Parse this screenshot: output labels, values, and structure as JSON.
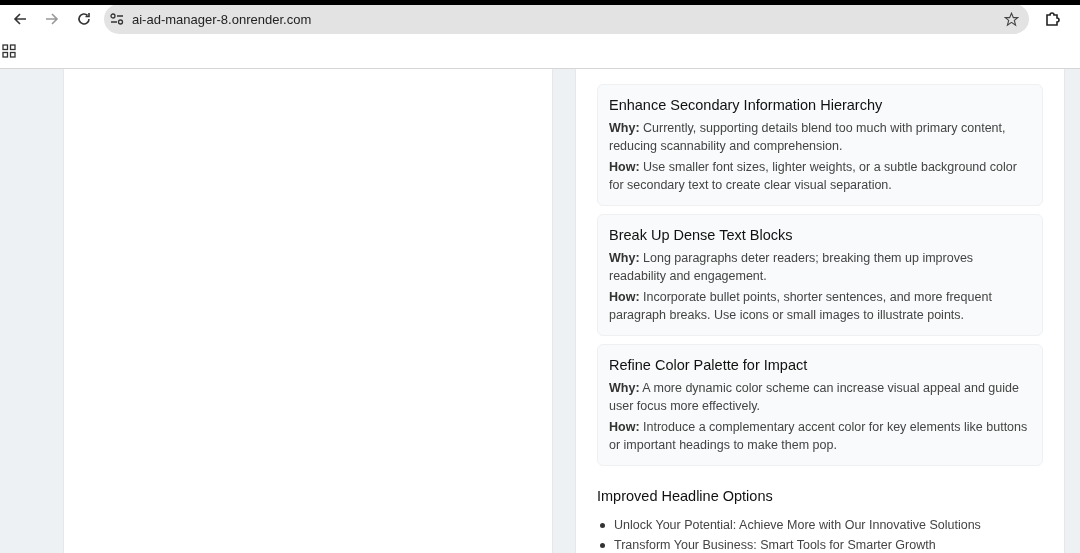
{
  "browser": {
    "url": "ai-ad-manager-8.onrender.com"
  },
  "fixes": [
    {
      "title": "Enhance Secondary Information Hierarchy",
      "why": "**Why:** Currently, supporting details blend too much with primary content, reducing scannability and comprehension.",
      "how": "**How:** Use smaller font sizes, lighter weights, or a subtle background color for secondary text to create clear visual separation."
    },
    {
      "title": "Break Up Dense Text Blocks",
      "why": "**Why:** Long paragraphs deter readers; breaking them up improves readability and engagement.",
      "how": "**How:** Incorporate bullet points, shorter sentences, and more frequent paragraph breaks. Use icons or small images to illustrate points."
    },
    {
      "title": "Refine Color Palette for Impact",
      "why": "**Why:** A more dynamic color scheme can increase visual appeal and guide user focus more effectively.",
      "how": "**How:** Introduce a complementary accent color for key elements like buttons or important headings to make them pop."
    }
  ],
  "headlines": {
    "title": "Improved Headline Options",
    "items": [
      "Unlock Your Potential: Achieve More with Our Innovative Solutions",
      "Transform Your Business: Smart Tools for Smarter Growth"
    ]
  }
}
